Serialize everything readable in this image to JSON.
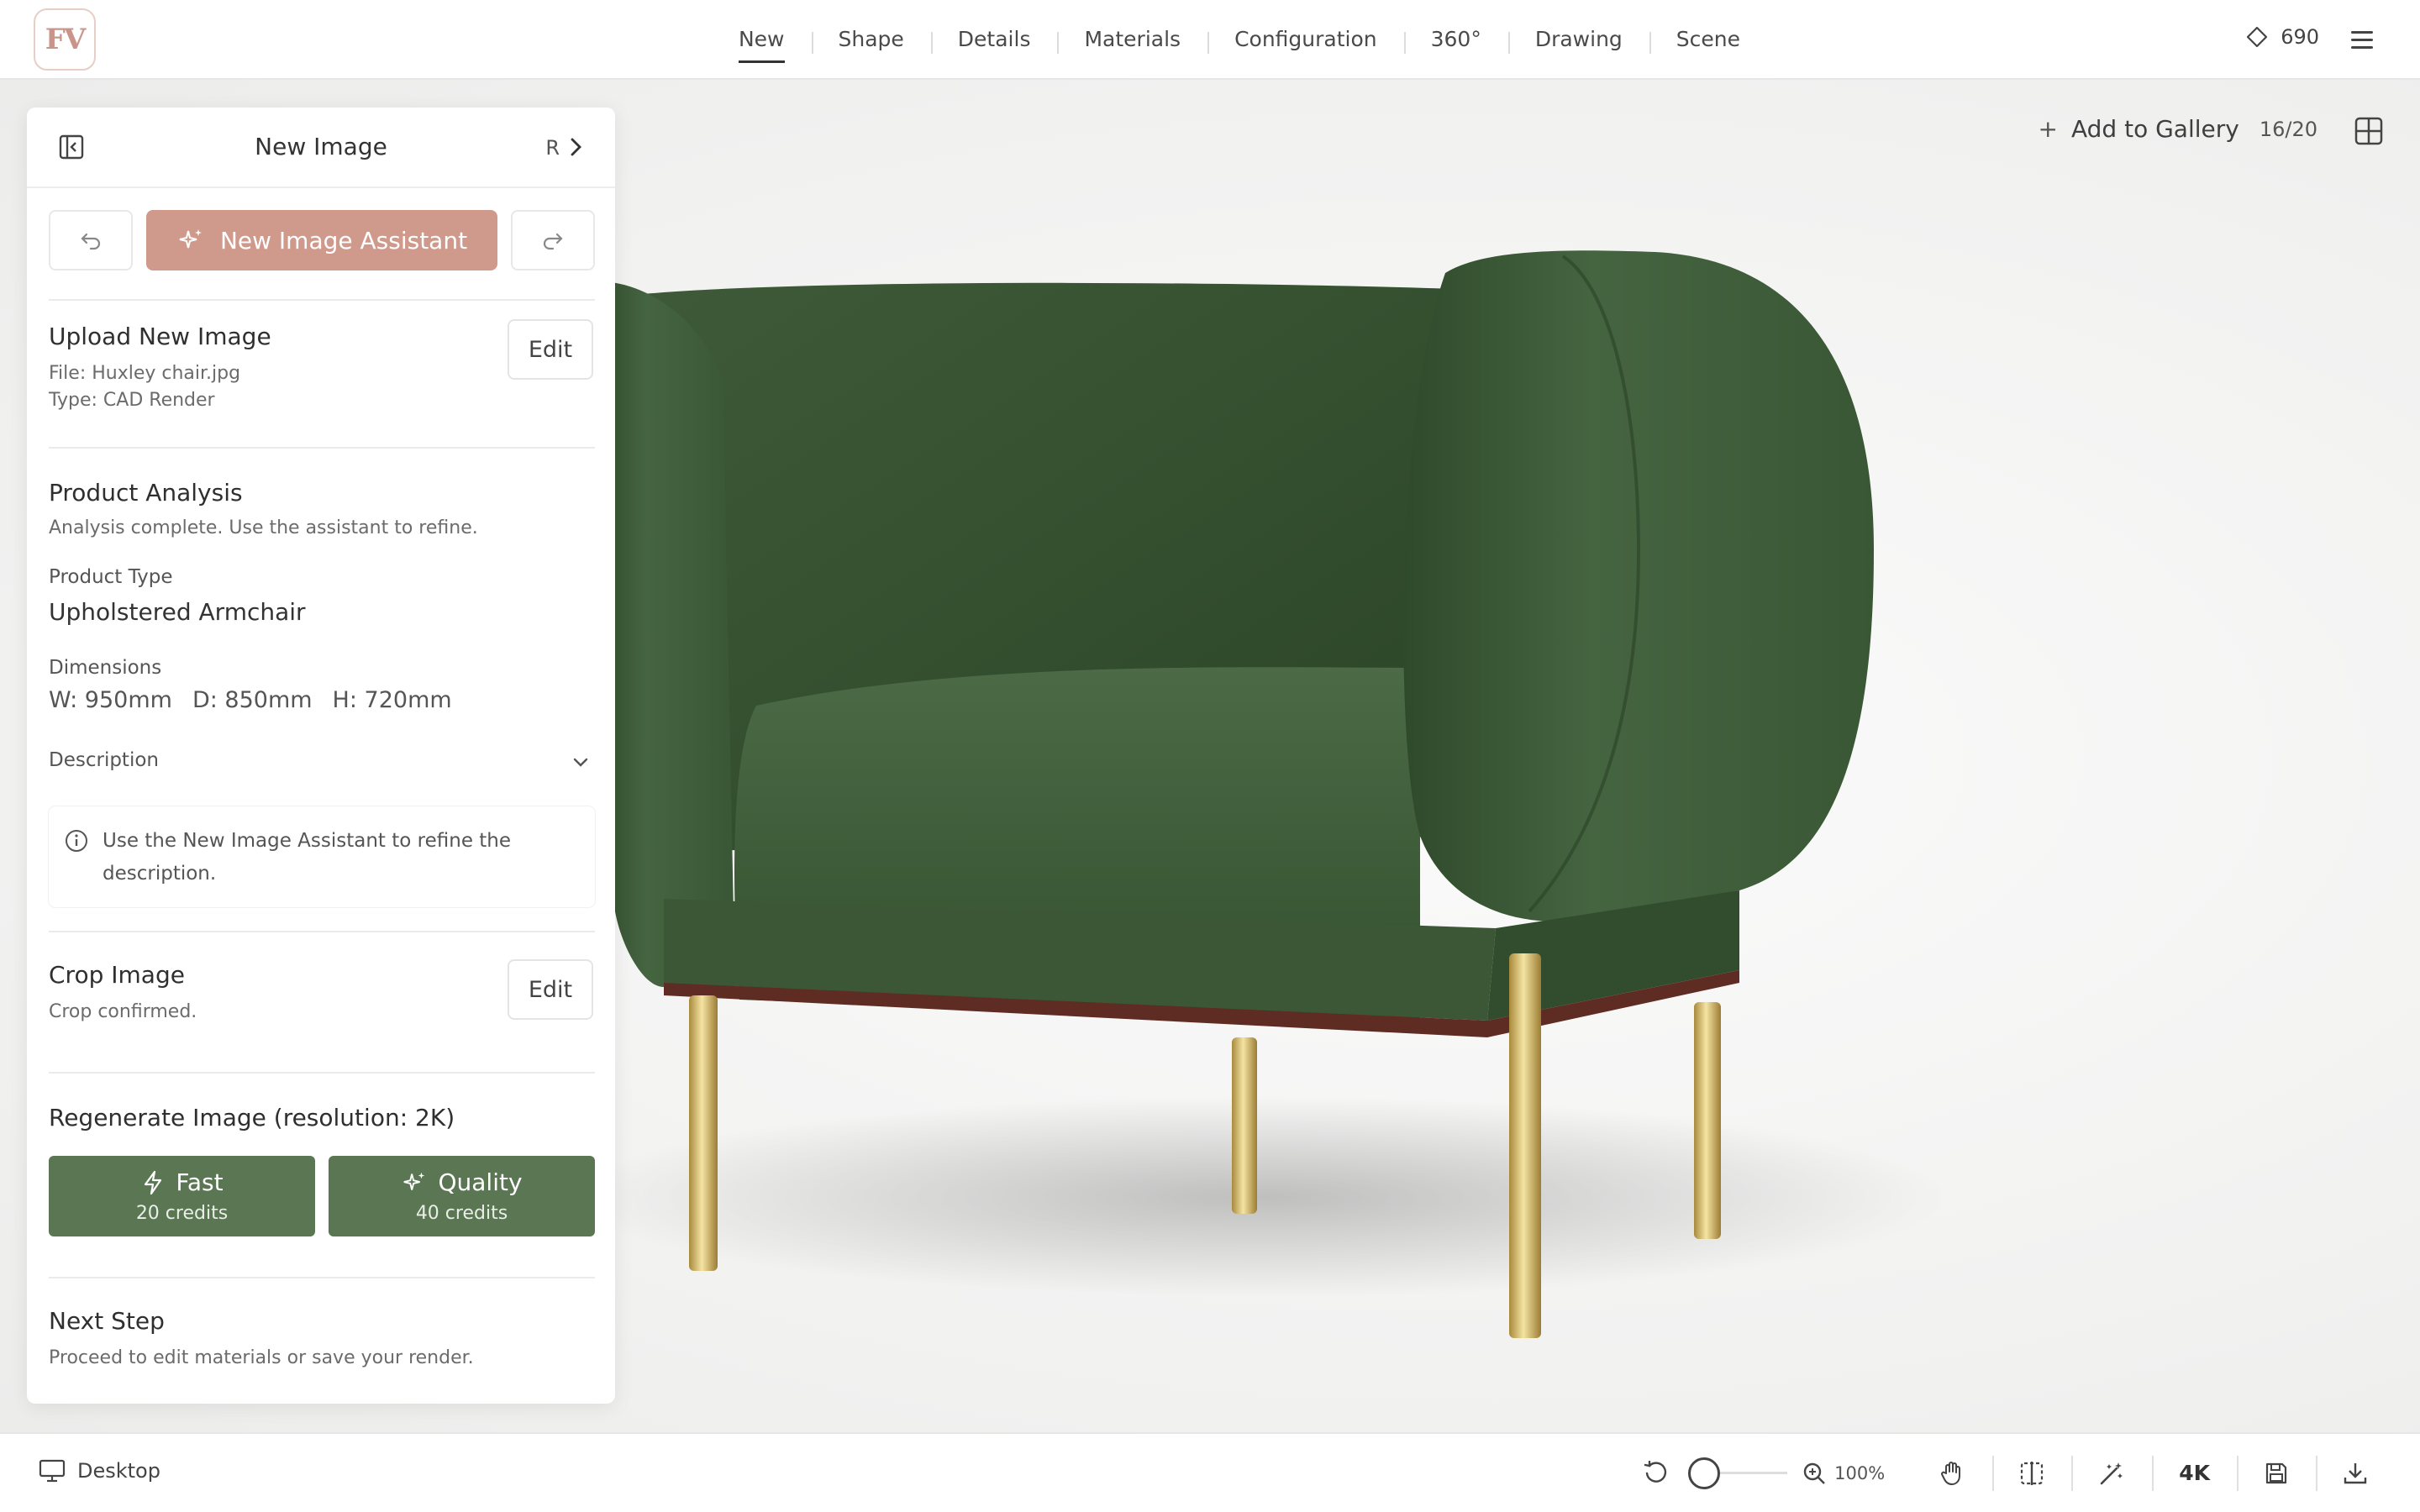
{
  "app": {
    "logo_text": "FV",
    "brand_color": "#cf9a8b",
    "accent_green": "#5a7653"
  },
  "nav": {
    "items": [
      "New",
      "Shape",
      "Details",
      "Materials",
      "Configuration",
      "360°",
      "Drawing",
      "Scene"
    ],
    "active": "New"
  },
  "header": {
    "credits": "690",
    "credits_icon": "diamond-icon",
    "menu_icon": "hamburger-icon"
  },
  "canvas": {
    "add_to_gallery_label": "Add to Gallery",
    "gallery_count": "16/20"
  },
  "panel": {
    "title": "New Image",
    "shortcut": "R",
    "assistant_button_label": "New Image Assistant",
    "upload": {
      "title": "Upload New Image",
      "file_line": "File: Huxley chair.jpg",
      "type_line": "Type: CAD Render",
      "edit_label": "Edit"
    },
    "analysis": {
      "title": "Product Analysis",
      "status": "Analysis complete. Use the assistant to refine.",
      "product_type_label": "Product Type",
      "product_type_value": "Upholstered Armchair",
      "dimensions_label": "Dimensions",
      "dim_w": "W: 950mm",
      "dim_d": "D: 850mm",
      "dim_h": "H: 720mm",
      "description_label": "Description",
      "info_text": "Use the New Image Assistant to refine the description."
    },
    "crop": {
      "title": "Crop Image",
      "status": "Crop confirmed.",
      "edit_label": "Edit"
    },
    "regenerate": {
      "title": "Regenerate Image (resolution: 2K)",
      "fast_label": "Fast",
      "fast_credits": "20 credits",
      "quality_label": "Quality",
      "quality_credits": "40 credits"
    },
    "next_step": {
      "title": "Next Step",
      "text": "Proceed to edit materials or save your render."
    }
  },
  "bottombar": {
    "device_label": "Desktop",
    "zoom_value": "100%",
    "resolution_label": "4K"
  }
}
